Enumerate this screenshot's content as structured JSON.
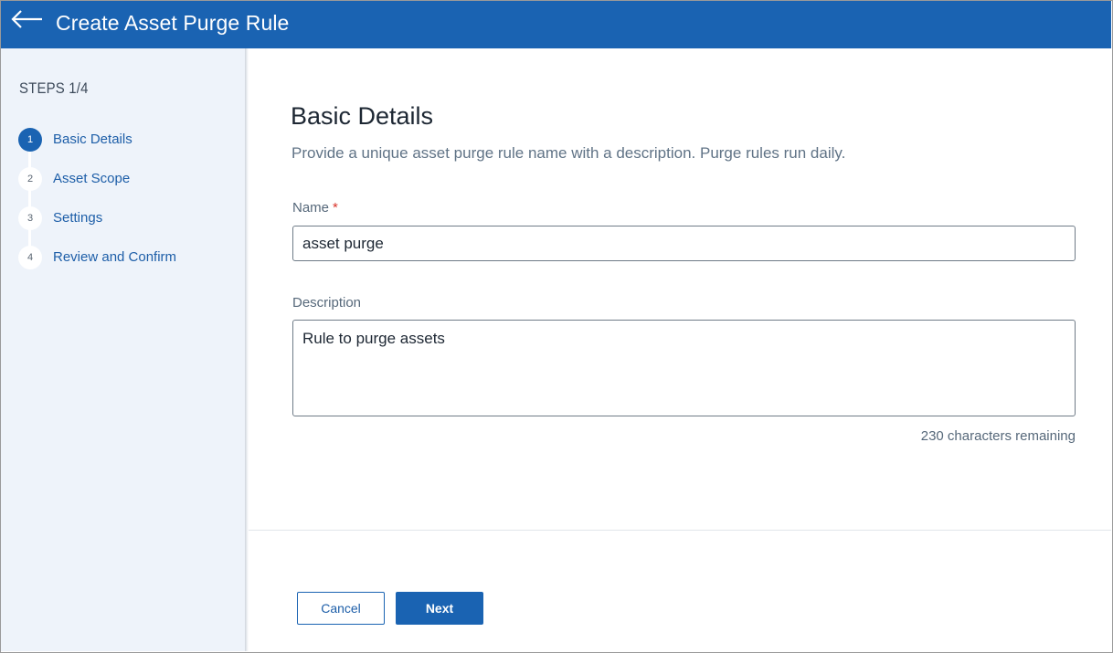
{
  "header": {
    "title": "Create Asset Purge Rule",
    "back_icon": "arrow-left-icon",
    "color": "#1a63b2"
  },
  "sidebar": {
    "heading": "STEPS 1/4",
    "steps": [
      {
        "number": "1",
        "label": "Basic Details",
        "active": true
      },
      {
        "number": "2",
        "label": "Asset Scope",
        "active": false
      },
      {
        "number": "3",
        "label": "Settings",
        "active": false
      },
      {
        "number": "4",
        "label": "Review and Confirm",
        "active": false
      }
    ]
  },
  "main": {
    "title": "Basic Details",
    "subtitle": "Provide a unique asset purge rule name with a description. Purge rules run daily.",
    "name_field": {
      "label": "Name",
      "required_marker": "*",
      "value": "asset purge"
    },
    "description_field": {
      "label": "Description",
      "value": "Rule to purge assets",
      "remaining": "230 characters remaining"
    }
  },
  "footer": {
    "cancel_label": "Cancel",
    "next_label": "Next"
  }
}
